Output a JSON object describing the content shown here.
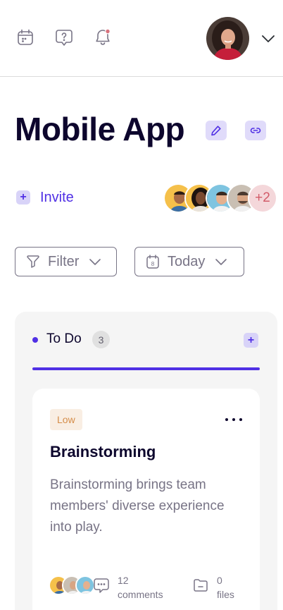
{
  "header": {
    "icons": [
      "calendar-icon",
      "help-icon",
      "notification-bell-icon"
    ],
    "user_avatar": "user-avatar"
  },
  "project": {
    "title": "Mobile App"
  },
  "invite": {
    "label": "Invite"
  },
  "members": {
    "extra_count": "+2"
  },
  "filters": {
    "filter_label": "Filter",
    "date_label": "Today",
    "date_day": "8"
  },
  "board": {
    "column": {
      "title": "To Do",
      "count": "3"
    },
    "card": {
      "priority": "Low",
      "title": "Brainstorming",
      "description": "Brainstorming brings team members' diverse experience into play.",
      "comments_count": "12",
      "comments_label": "comments",
      "files_count": "0",
      "files_label": "files"
    }
  },
  "colors": {
    "accent": "#5030e5",
    "accent_light": "#d8d3f8",
    "priority_low_bg": "#f9eee3",
    "priority_low_text": "#d58d49",
    "notification_dot": "#d8727d"
  }
}
